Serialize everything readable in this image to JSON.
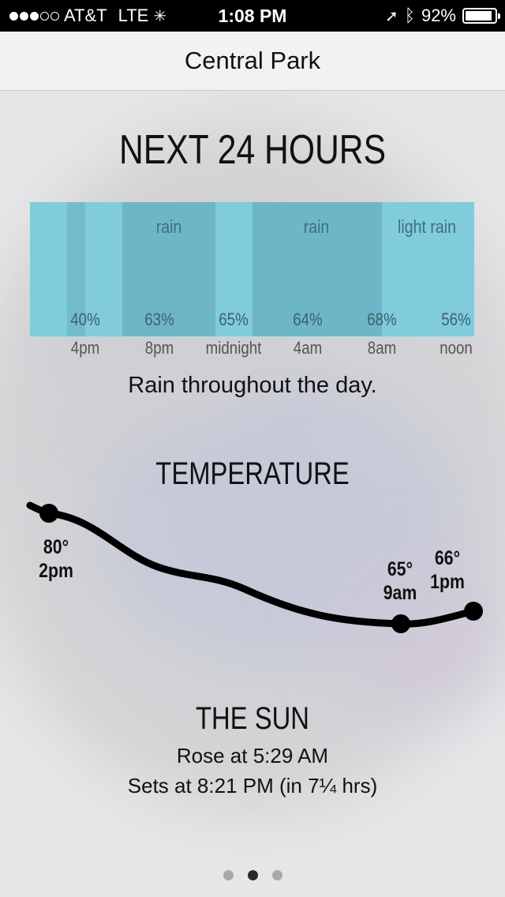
{
  "status_bar": {
    "carrier": "AT&T",
    "network": "LTE",
    "time": "1:08 PM",
    "battery": "92%",
    "battery_level": 0.92
  },
  "nav": {
    "title": "Central Park"
  },
  "forecast": {
    "heading": "NEXT 24 HOURS",
    "rain_labels": [
      "rain",
      "rain",
      "light rain"
    ],
    "percentages": [
      "40%",
      "63%",
      "65%",
      "64%",
      "68%",
      "56%"
    ],
    "time_labels": [
      "4pm",
      "8pm",
      "midnight",
      "4am",
      "8am",
      "noon"
    ],
    "summary": "Rain throughout the day."
  },
  "temperature": {
    "heading": "TEMPERATURE",
    "points": [
      {
        "temp": "80°",
        "time": "2pm"
      },
      {
        "temp": "65°",
        "time": "9am"
      },
      {
        "temp": "66°",
        "time": "1pm"
      }
    ]
  },
  "sun": {
    "heading": "THE SUN",
    "rose": "Rose at 5:29 AM",
    "sets": "Sets at 8:21 PM (in 7¼ hrs)"
  },
  "pager": {
    "pages": 3,
    "active": 1
  },
  "colors": {
    "rain_light": "#7ecadb",
    "rain_dark": "#6db6c7",
    "curve": "#000000"
  }
}
